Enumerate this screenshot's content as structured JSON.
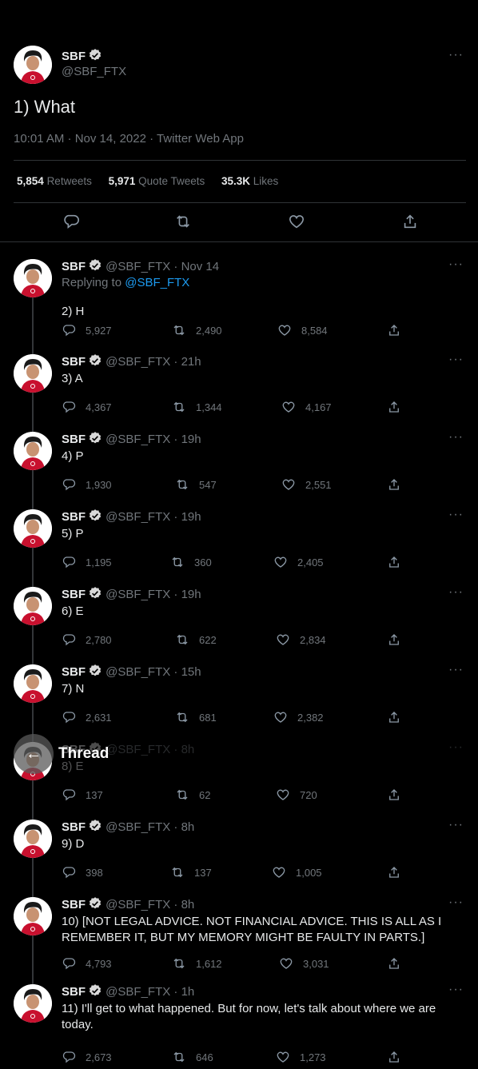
{
  "main": {
    "name": "SBF",
    "handle": "@SBF_FTX",
    "text": "1) What",
    "meta": "10:01 AM · Nov 14, 2022 · Twitter Web App",
    "retweets_count": "5,854",
    "retweets_label": "Retweets",
    "quotes_count": "5,971",
    "quotes_label": "Quote Tweets",
    "likes_count": "35.3K",
    "likes_label": "Likes"
  },
  "more_glyph": "···",
  "replying_prefix": "Replying to",
  "replying_handle": "@SBF_FTX",
  "thread_header": {
    "title": "Thread",
    "back_glyph": "←"
  },
  "replies": [
    {
      "name": "SBF",
      "handle": "@SBF_FTX",
      "time": "· Nov 14",
      "text": "2) H",
      "replies": "5,927",
      "retweets": "2,490",
      "likes": "8,584"
    },
    {
      "name": "SBF",
      "handle": "@SBF_FTX",
      "time": "· 21h",
      "text": "3) A",
      "replies": "4,367",
      "retweets": "1,344",
      "likes": "4,167"
    },
    {
      "name": "SBF",
      "handle": "@SBF_FTX",
      "time": "· 19h",
      "text": "4) P",
      "replies": "1,930",
      "retweets": "547",
      "likes": "2,551"
    },
    {
      "name": "SBF",
      "handle": "@SBF_FTX",
      "time": "· 19h",
      "text": "5) P",
      "replies": "1,195",
      "retweets": "360",
      "likes": "2,405"
    },
    {
      "name": "SBF",
      "handle": "@SBF_FTX",
      "time": "· 19h",
      "text": "6) E",
      "replies": "2,780",
      "retweets": "622",
      "likes": "2,834"
    },
    {
      "name": "SBF",
      "handle": "@SBF_FTX",
      "time": "· 15h",
      "text": "7) N",
      "replies": "2,631",
      "retweets": "681",
      "likes": "2,382"
    },
    {
      "name": "SBF",
      "handle": "@SBF_FTX",
      "time": "· 8h",
      "text": "8) E",
      "replies": "137",
      "retweets": "62",
      "likes": "720"
    },
    {
      "name": "SBF",
      "handle": "@SBF_FTX",
      "time": "· 8h",
      "text": "9) D",
      "replies": "398",
      "retweets": "137",
      "likes": "1,005"
    },
    {
      "name": "SBF",
      "handle": "@SBF_FTX",
      "time": "· 8h",
      "text": "10) [NOT LEGAL ADVICE.  NOT FINANCIAL ADVICE.  THIS IS ALL AS I REMEMBER IT, BUT MY MEMORY MIGHT BE FAULTY IN PARTS.]",
      "replies": "4,793",
      "retweets": "1,612",
      "likes": "3,031"
    },
    {
      "name": "SBF",
      "handle": "@SBF_FTX",
      "time": "· 1h",
      "text": "11) I'll get to what happened.  But for now, let's talk about where we are today.",
      "replies": "2,673",
      "retweets": "646",
      "likes": "1,273"
    }
  ],
  "colors": {
    "background": "#000000",
    "text": "#e7e9ea",
    "muted": "#71767b",
    "link": "#1d9bf0",
    "verified": "#d9d9d9",
    "avatar_shirt": "#c8102e"
  }
}
